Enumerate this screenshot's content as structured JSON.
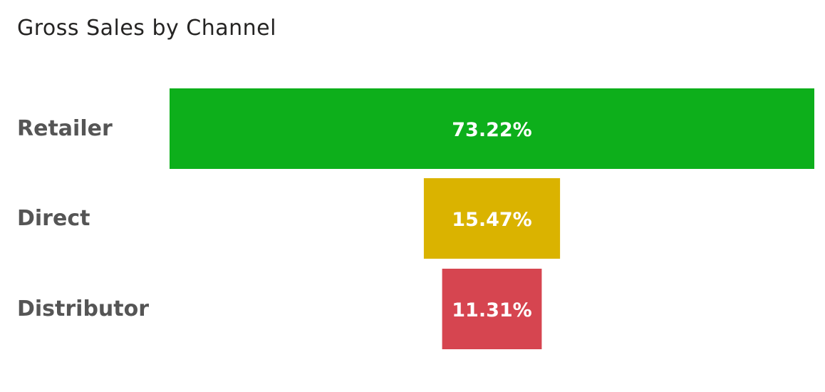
{
  "chart_data": {
    "type": "bar",
    "subtype": "funnel",
    "title": "Gross Sales by Channel",
    "categories": [
      "Retailer",
      "Direct",
      "Distributor"
    ],
    "values": [
      73.22,
      15.47,
      11.31
    ],
    "value_labels": [
      "73.22%",
      "15.47%",
      "11.31%"
    ],
    "unit": "%",
    "colors": [
      "#0DAF1B",
      "#DAB300",
      "#D64550"
    ],
    "grid": false,
    "legend": "none"
  }
}
